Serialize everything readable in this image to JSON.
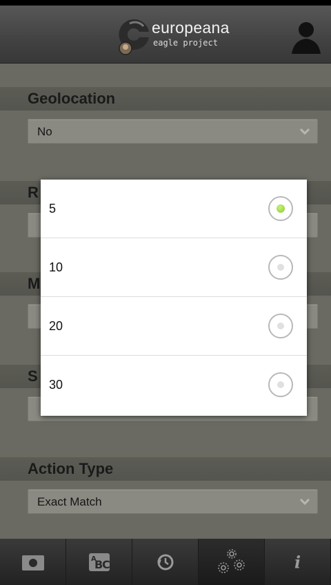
{
  "header": {
    "logo_title": "europeana",
    "logo_subtitle": "eagle project",
    "icons": {
      "logo": "europeana-eagle-logo",
      "user": "user-icon"
    }
  },
  "sections": [
    {
      "title": "Geolocation",
      "value": "No"
    },
    {
      "title": "R",
      "value": ""
    },
    {
      "title": "M",
      "value": ""
    },
    {
      "title": "S",
      "value": ""
    },
    {
      "title": "Action Type",
      "value": "Exact Match"
    }
  ],
  "dialog": {
    "options": [
      {
        "label": "5",
        "selected": true
      },
      {
        "label": "10",
        "selected": false
      },
      {
        "label": "20",
        "selected": false
      },
      {
        "label": "30",
        "selected": false
      }
    ],
    "selected_color": "#8ac92b"
  },
  "tabbar": {
    "tabs": [
      {
        "icon": "camera-icon"
      },
      {
        "icon": "text-recognition-icon"
      },
      {
        "icon": "history-icon"
      },
      {
        "icon": "settings-icon",
        "active": true
      },
      {
        "icon": "info-icon"
      }
    ]
  }
}
